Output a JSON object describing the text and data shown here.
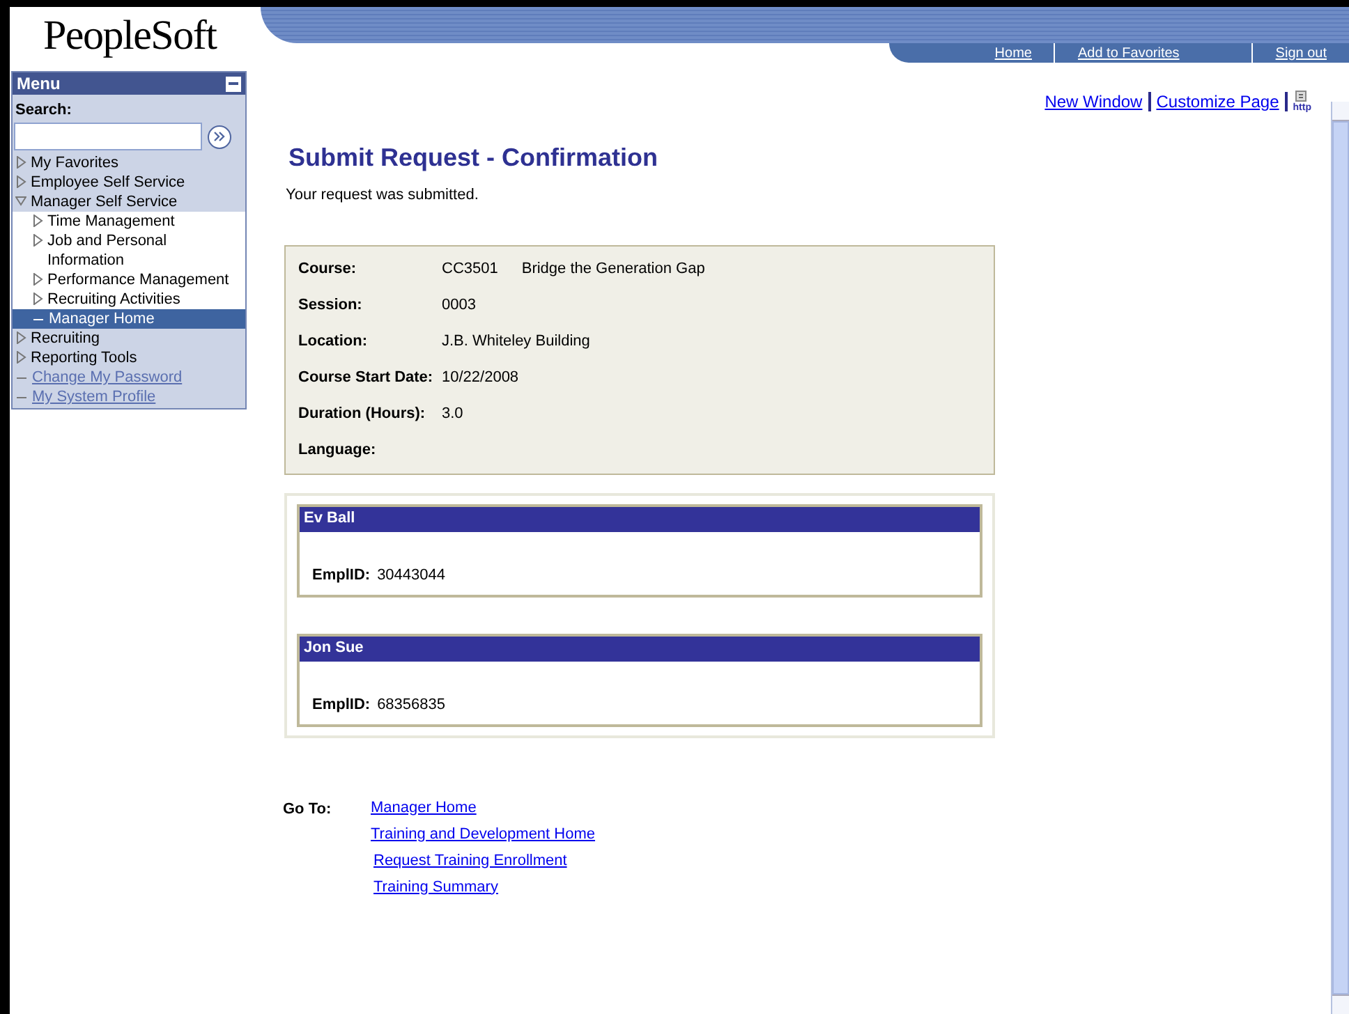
{
  "logo": "PeopleSoft",
  "header_links": [
    "Home",
    "Add to Favorites",
    "Sign out"
  ],
  "menu": {
    "title": "Menu",
    "search_label": "Search:",
    "items": [
      {
        "label": "My Favorites",
        "kind": "folder",
        "expanded": false,
        "selected": false
      },
      {
        "label": "Employee Self Service",
        "kind": "folder",
        "expanded": false,
        "selected": false
      },
      {
        "label": "Manager Self Service",
        "kind": "folder",
        "expanded": true,
        "selected": false,
        "children": [
          {
            "label": "Time Management",
            "kind": "folder",
            "expanded": false,
            "selected": false
          },
          {
            "label": "Job and Personal Information",
            "kind": "folder",
            "expanded": false,
            "selected": false
          },
          {
            "label": "Performance Management",
            "kind": "folder",
            "expanded": false,
            "selected": false
          },
          {
            "label": "Recruiting Activities",
            "kind": "folder",
            "expanded": false,
            "selected": false
          },
          {
            "label": "Manager Home",
            "kind": "page",
            "selected": true
          }
        ]
      },
      {
        "label": "Recruiting",
        "kind": "folder",
        "expanded": false,
        "selected": false
      },
      {
        "label": "Reporting Tools",
        "kind": "folder",
        "expanded": false,
        "selected": false
      },
      {
        "label": "Change My Password",
        "kind": "link",
        "selected": false
      },
      {
        "label": "My System Profile",
        "kind": "link",
        "selected": false
      }
    ]
  },
  "page_links": [
    "New Window",
    "Customize Page"
  ],
  "http_label": "http",
  "title": "Submit Request - Confirmation",
  "message": "Your request was submitted.",
  "details": [
    {
      "label": "Course:",
      "values": [
        "CC3501",
        "Bridge the Generation Gap"
      ]
    },
    {
      "label": "Session:",
      "values": [
        "0003"
      ]
    },
    {
      "label": "Location:",
      "values": [
        "J.B. Whiteley Building"
      ]
    },
    {
      "label": "Course Start Date:",
      "values": [
        "10/22/2008"
      ]
    },
    {
      "label": "Duration (Hours):",
      "values": [
        "3.0"
      ]
    },
    {
      "label": "Language:"
    }
  ],
  "employees": [
    {
      "name": "Ev Ball",
      "id_label": "EmplID:",
      "id": "30443044"
    },
    {
      "name": "Jon Sue",
      "id_label": "EmplID:",
      "id": "68356835"
    }
  ],
  "goto": {
    "label": "Go To:",
    "links": [
      "Manager Home",
      "Training and Development Home",
      "Request Training Enrollment",
      "Training Summary"
    ]
  }
}
